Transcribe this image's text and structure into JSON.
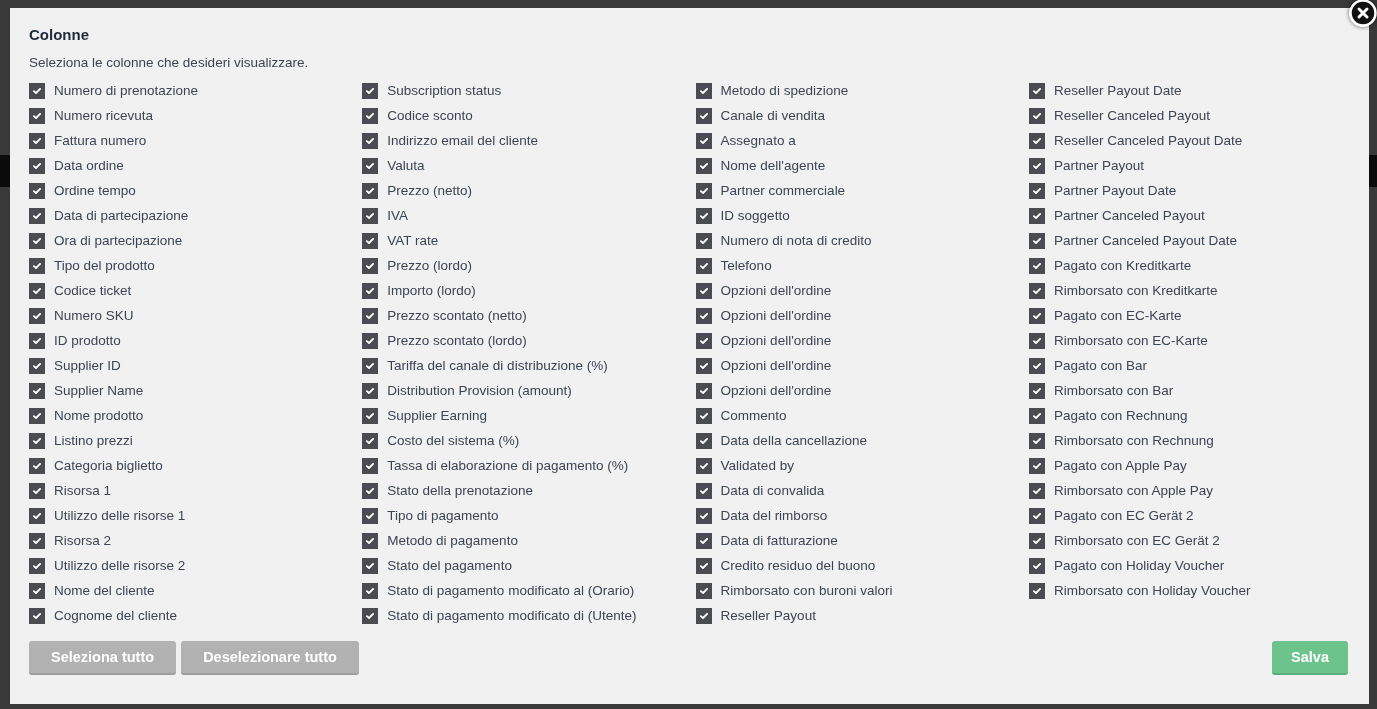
{
  "dialog": {
    "title": "Colonne",
    "subtitle": "Seleziona le colonne che desideri visualizzare."
  },
  "columns": [
    {
      "items": [
        {
          "label": "Numero di prenotazione",
          "checked": true
        },
        {
          "label": "Numero ricevuta",
          "checked": true
        },
        {
          "label": "Fattura numero",
          "checked": true
        },
        {
          "label": "Data ordine",
          "checked": true
        },
        {
          "label": "Ordine tempo",
          "checked": true
        },
        {
          "label": "Data di partecipazione",
          "checked": true
        },
        {
          "label": "Ora di partecipazione",
          "checked": true
        },
        {
          "label": "Tipo del prodotto",
          "checked": true
        },
        {
          "label": "Codice ticket",
          "checked": true
        },
        {
          "label": "Numero SKU",
          "checked": true
        },
        {
          "label": "ID prodotto",
          "checked": true
        },
        {
          "label": "Supplier ID",
          "checked": true
        },
        {
          "label": "Supplier Name",
          "checked": true
        },
        {
          "label": "Nome prodotto",
          "checked": true
        },
        {
          "label": "Listino prezzi",
          "checked": true
        },
        {
          "label": "Categoria biglietto",
          "checked": true
        },
        {
          "label": "Risorsa 1",
          "checked": true
        },
        {
          "label": "Utilizzo delle risorse 1",
          "checked": true
        },
        {
          "label": "Risorsa 2",
          "checked": true
        },
        {
          "label": "Utilizzo delle risorse 2",
          "checked": true
        },
        {
          "label": "Nome del cliente",
          "checked": true
        },
        {
          "label": "Cognome del cliente",
          "checked": true
        }
      ]
    },
    {
      "items": [
        {
          "label": "Subscription status",
          "checked": true
        },
        {
          "label": "Codice sconto",
          "checked": true
        },
        {
          "label": "Indirizzo email del cliente",
          "checked": true
        },
        {
          "label": "Valuta",
          "checked": true
        },
        {
          "label": "Prezzo (netto)",
          "checked": true
        },
        {
          "label": "IVA",
          "checked": true
        },
        {
          "label": "VAT rate",
          "checked": true
        },
        {
          "label": "Prezzo (lordo)",
          "checked": true
        },
        {
          "label": "Importo (lordo)",
          "checked": true
        },
        {
          "label": "Prezzo scontato (netto)",
          "checked": true
        },
        {
          "label": "Prezzo scontato (lordo)",
          "checked": true
        },
        {
          "label": "Tariffa del canale di distribuzione (%)",
          "checked": true
        },
        {
          "label": "Distribution Provision (amount)",
          "checked": true
        },
        {
          "label": "Supplier Earning",
          "checked": true
        },
        {
          "label": "Costo del sistema (%)",
          "checked": true
        },
        {
          "label": "Tassa di elaborazione di pagamento (%)",
          "checked": true
        },
        {
          "label": "Stato della prenotazione",
          "checked": true
        },
        {
          "label": "Tipo di pagamento",
          "checked": true
        },
        {
          "label": "Metodo di pagamento",
          "checked": true
        },
        {
          "label": "Stato del pagamento",
          "checked": true
        },
        {
          "label": "Stato di pagamento modificato al (Orario)",
          "checked": true
        },
        {
          "label": "Stato di pagamento modificato di (Utente)",
          "checked": true
        }
      ]
    },
    {
      "items": [
        {
          "label": "Metodo di spedizione",
          "checked": true
        },
        {
          "label": "Canale di vendita",
          "checked": true
        },
        {
          "label": "Assegnato a",
          "checked": true
        },
        {
          "label": "Nome dell'agente",
          "checked": true
        },
        {
          "label": "Partner commerciale",
          "checked": true
        },
        {
          "label": "ID soggetto",
          "checked": true
        },
        {
          "label": "Numero di nota di credito",
          "checked": true
        },
        {
          "label": "Telefono",
          "checked": true
        },
        {
          "label": "Opzioni dell'ordine",
          "checked": true
        },
        {
          "label": "Opzioni dell'ordine",
          "checked": true
        },
        {
          "label": "Opzioni dell'ordine",
          "checked": true
        },
        {
          "label": "Opzioni dell'ordine",
          "checked": true
        },
        {
          "label": "Opzioni dell'ordine",
          "checked": true
        },
        {
          "label": "Commento",
          "checked": true
        },
        {
          "label": "Data della cancellazione",
          "checked": true
        },
        {
          "label": "Validated by",
          "checked": true
        },
        {
          "label": "Data di convalida",
          "checked": true
        },
        {
          "label": "Data del rimborso",
          "checked": true
        },
        {
          "label": "Data di fatturazione",
          "checked": true
        },
        {
          "label": "Credito residuo del buono",
          "checked": true
        },
        {
          "label": "Rimborsato con buroni valori",
          "checked": true
        },
        {
          "label": "Reseller Payout",
          "checked": true
        }
      ]
    },
    {
      "items": [
        {
          "label": "Reseller Payout Date",
          "checked": true
        },
        {
          "label": "Reseller Canceled Payout",
          "checked": true
        },
        {
          "label": "Reseller Canceled Payout Date",
          "checked": true
        },
        {
          "label": "Partner Payout",
          "checked": true
        },
        {
          "label": "Partner Payout Date",
          "checked": true
        },
        {
          "label": "Partner Canceled Payout",
          "checked": true
        },
        {
          "label": "Partner Canceled Payout Date",
          "checked": true
        },
        {
          "label": "Pagato con Kreditkarte",
          "checked": true
        },
        {
          "label": "Rimborsato con Kreditkarte",
          "checked": true
        },
        {
          "label": "Pagato con EC-Karte",
          "checked": true
        },
        {
          "label": "Rimborsato con EC-Karte",
          "checked": true
        },
        {
          "label": "Pagato con Bar",
          "checked": true
        },
        {
          "label": "Rimborsato con Bar",
          "checked": true
        },
        {
          "label": "Pagato con Rechnung",
          "checked": true
        },
        {
          "label": "Rimborsato con Rechnung",
          "checked": true
        },
        {
          "label": "Pagato con Apple Pay",
          "checked": true
        },
        {
          "label": "Rimborsato con Apple Pay",
          "checked": true
        },
        {
          "label": "Pagato con EC Gerät 2",
          "checked": true
        },
        {
          "label": "Rimborsato con EC Gerät 2",
          "checked": true
        },
        {
          "label": "Pagato con Holiday Voucher",
          "checked": true
        },
        {
          "label": "Rimborsato con Holiday Voucher",
          "checked": true
        }
      ]
    }
  ],
  "buttons": [
    {
      "label": "Seleziona tutto",
      "kind": "secondary"
    },
    {
      "label": "Deselezionare tutto",
      "kind": "secondary"
    },
    {
      "label": "Salva",
      "kind": "primary"
    }
  ]
}
